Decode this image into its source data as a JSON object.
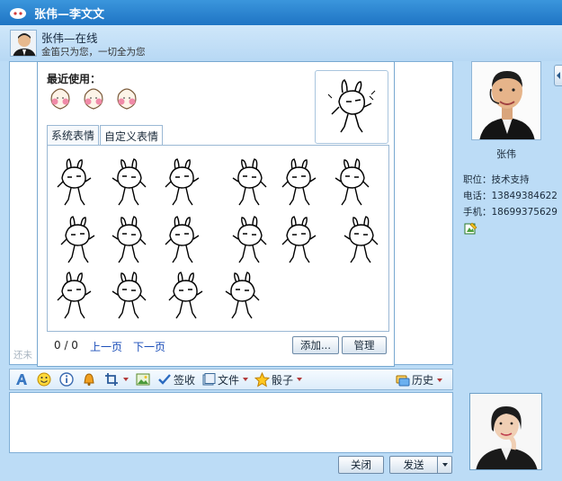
{
  "window": {
    "title": "张伟—李文文"
  },
  "contact": {
    "name_status": "张伟—在线",
    "signature": "金笛只为您，一切全为您"
  },
  "chat": {
    "faded_text": "还未"
  },
  "emoticon_panel": {
    "recent_label": "最近使用：",
    "tabs": [
      {
        "label": "系统表情"
      },
      {
        "label": "自定义表情"
      }
    ],
    "active_tab": 1,
    "page_indicator": "0 / 0",
    "prev_page": "上一页",
    "next_page": "下一页",
    "add_button": "添加...",
    "manage_button": "管理"
  },
  "toolbar": {
    "font_icon": "font-icon",
    "emoticon_icon": "smiley-icon",
    "info_icon": "info-icon",
    "shake_icon": "bell-icon",
    "screenshot_icon": "crop-icon",
    "image_icon": "image-icon",
    "sign_label": "签收",
    "file_label": "文件",
    "dice_label": "骰子",
    "history_label": "历史"
  },
  "buttons": {
    "close": "关闭",
    "send": "发送"
  },
  "profile": {
    "name": "张伟",
    "position": "职位：技术支持",
    "phone": "电话：13849384622",
    "mobile": "手机：18699375629"
  },
  "colors": {
    "title_bar": "#2a85d1",
    "panel": "#bcdcf6",
    "link": "#1a4db8"
  }
}
